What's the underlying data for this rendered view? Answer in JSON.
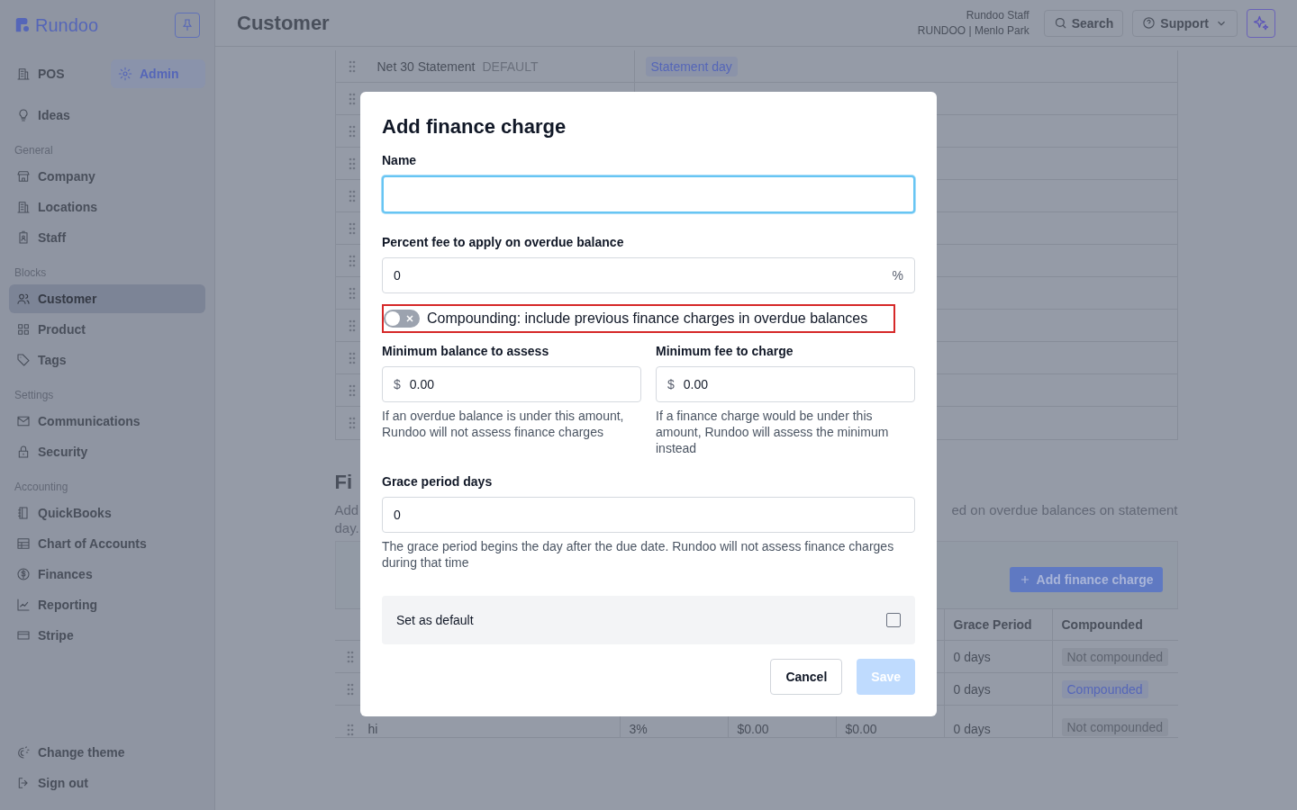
{
  "sidebar": {
    "brand": "Rundoo",
    "modes": [
      {
        "label": "POS",
        "selected": false
      },
      {
        "label": "Admin",
        "selected": true
      }
    ],
    "top_items": [
      {
        "label": "Ideas",
        "selected": false
      }
    ],
    "sections": [
      {
        "heading": "General",
        "items": [
          {
            "label": "Company",
            "selected": false
          },
          {
            "label": "Locations",
            "selected": false
          },
          {
            "label": "Staff",
            "selected": false
          }
        ]
      },
      {
        "heading": "Blocks",
        "items": [
          {
            "label": "Customer",
            "selected": true
          },
          {
            "label": "Product",
            "selected": false
          },
          {
            "label": "Tags",
            "selected": false
          }
        ]
      },
      {
        "heading": "Settings",
        "items": [
          {
            "label": "Communications",
            "selected": false
          },
          {
            "label": "Security",
            "selected": false
          }
        ]
      },
      {
        "heading": "Accounting",
        "items": [
          {
            "label": "QuickBooks",
            "selected": false
          },
          {
            "label": "Chart of Accounts",
            "selected": false
          },
          {
            "label": "Finances",
            "selected": false
          },
          {
            "label": "Reporting",
            "selected": false
          },
          {
            "label": "Stripe",
            "selected": false
          }
        ]
      }
    ],
    "footer_items": [
      "Change theme",
      "Sign out"
    ]
  },
  "header": {
    "title": "Customer",
    "user_name": "Rundoo Staff",
    "user_location": "RUNDOO | Menlo Park",
    "search_button": "Search",
    "support_button": "Support"
  },
  "terms_table": {
    "rows": [
      {
        "name": "Net 30 Statement",
        "badge": "DEFAULT",
        "column_2": "Statement day"
      },
      {},
      {},
      {},
      {},
      {},
      {},
      {},
      {},
      {},
      {},
      {}
    ]
  },
  "finance_section": {
    "heading": "Fi",
    "description_left": [
      "Add",
      "day."
    ],
    "description_right": "ed on overdue balances on statement",
    "add_button": "Add finance charge",
    "columns": [
      {
        "label": "Grace Period"
      },
      {
        "label": "Compounded"
      }
    ],
    "rows": [
      {
        "grace_period": "0 days",
        "compounded": {
          "label": "Not compounded",
          "on": false
        }
      },
      {
        "grace_period": "0 days",
        "compounded": {
          "label": "Compounded",
          "on": true
        }
      },
      {
        "column_1": "hi",
        "column_2": "3%",
        "column_3": "$0.00",
        "column_4": "$0.00",
        "grace_period": "0 days",
        "compounded": {
          "label": "Not compounded",
          "on": false
        }
      }
    ]
  },
  "modal": {
    "title": "Add finance charge",
    "name_field": {
      "label": "Name",
      "focused": true
    },
    "percent_field": {
      "label": "Percent fee to apply on overdue balance",
      "value": "0",
      "suffix": "%"
    },
    "compounding_toggle": {
      "label": "Compounding: include previous finance charges in overdue balances",
      "on": false,
      "highlighted": true
    },
    "minimum_balance": {
      "label": "Minimum balance to assess",
      "prefix": "$",
      "value": "0.00",
      "help": "If an overdue balance is under this amount, Rundoo will not assess finance charges"
    },
    "minimum_fee": {
      "label": "Minimum fee to charge",
      "prefix": "$",
      "value": "0.00",
      "help": "If a finance charge would be under this amount, Rundoo will assess the minimum instead"
    },
    "grace_period": {
      "label": "Grace period days",
      "value": "0",
      "help": "The grace period begins the day after the due date. Rundoo will not assess finance charges during that time"
    },
    "set_default": {
      "label": "Set as default",
      "checked": false
    },
    "cancel_button": "Cancel",
    "save_button": {
      "label": "Save",
      "disabled": true
    }
  }
}
